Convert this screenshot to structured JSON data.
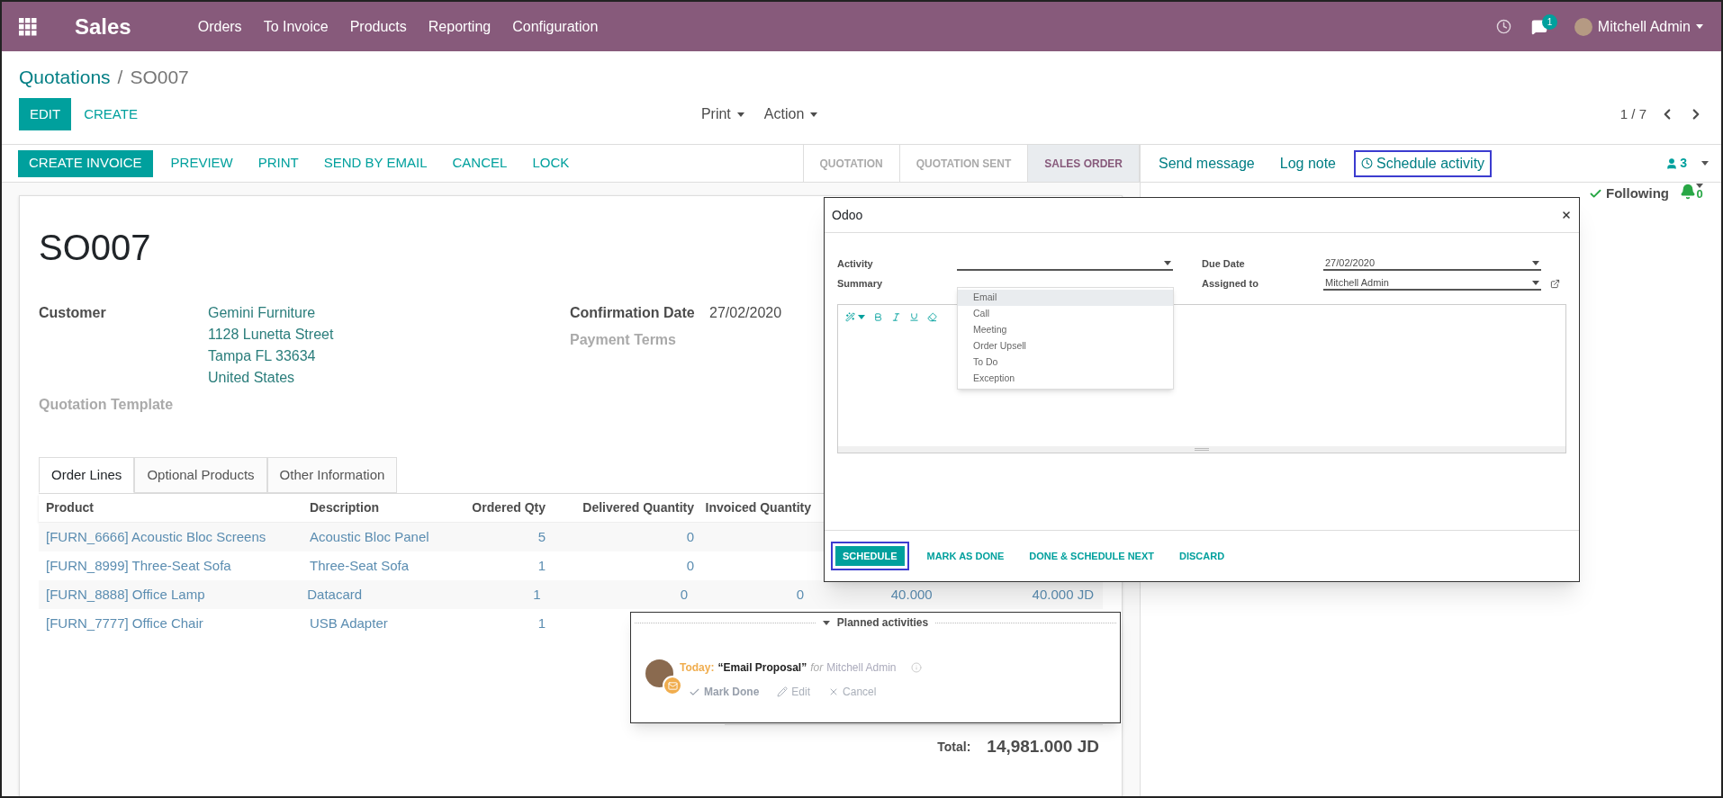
{
  "top_bar": {
    "app_name": "Sales",
    "menu": [
      "Orders",
      "To Invoice",
      "Products",
      "Reporting",
      "Configuration"
    ],
    "messages_badge": "1",
    "user_name": "Mitchell Admin"
  },
  "breadcrumb": {
    "parent": "Quotations",
    "separator": "/",
    "current": "SO007"
  },
  "control_panel": {
    "edit": "EDIT",
    "create": "CREATE",
    "dropdowns": [
      "Print",
      "Action"
    ],
    "pager": "1 / 7"
  },
  "status_bar": {
    "buttons": [
      {
        "label": "CREATE INVOICE",
        "kind": "primary"
      },
      {
        "label": "PREVIEW",
        "kind": "link"
      },
      {
        "label": "PRINT",
        "kind": "link"
      },
      {
        "label": "SEND BY EMAIL",
        "kind": "link"
      },
      {
        "label": "CANCEL",
        "kind": "link"
      },
      {
        "label": "LOCK",
        "kind": "link"
      }
    ],
    "stages": [
      {
        "label": "QUOTATION",
        "selected": false
      },
      {
        "label": "QUOTATION SENT",
        "selected": false
      },
      {
        "label": "SALES ORDER",
        "selected": true
      }
    ]
  },
  "chatter": {
    "buttons": [
      {
        "label": "Send message",
        "highlighted": false
      },
      {
        "label": "Log note",
        "highlighted": false
      },
      {
        "label": "Schedule activity",
        "highlighted": true
      }
    ],
    "followers_count": "3",
    "following": "Following",
    "notifications_count": "0"
  },
  "form": {
    "title": "SO007",
    "fields_left": [
      {
        "label": "Customer",
        "empty": false,
        "lines": [
          "Gemini Furniture",
          "1128 Lunetta Street",
          "Tampa FL 33634",
          "United States"
        ]
      },
      {
        "label": "Quotation Template",
        "empty": true
      }
    ],
    "fields_right": [
      {
        "label": "Confirmation Date",
        "empty": false,
        "value": "27/02/2020"
      },
      {
        "label": "Payment Terms",
        "empty": true
      }
    ],
    "tabs": [
      {
        "label": "Order Lines",
        "selected": true
      },
      {
        "label": "Optional Products",
        "selected": false
      },
      {
        "label": "Other Information",
        "selected": false
      }
    ],
    "table": {
      "columns": [
        "Product",
        "Description",
        "Ordered Qty",
        "Delivered Quantity",
        "Invoiced Quantity"
      ],
      "rows": [
        {
          "cells": [
            "[FURN_6666] Acoustic Bloc Screens",
            "Acoustic Bloc Panel",
            "5",
            "0"
          ]
        },
        {
          "cells": [
            "[FURN_8999] Three-Seat Sofa",
            "Three-Seat Sofa",
            "1",
            "0"
          ]
        },
        {
          "cells": [
            "[FURN_8888] Office Lamp",
            "Datacard",
            "1",
            "0",
            "0",
            "40.000",
            "40.000 JD"
          ]
        },
        {
          "cells": [
            "[FURN_7777] Office Chair",
            "USB Adapter",
            "1"
          ]
        }
      ]
    },
    "total": {
      "label": "Total:",
      "value": "14,981.000 JD"
    }
  },
  "dialog": {
    "title": "Odoo",
    "activity": {
      "label": "Activity"
    },
    "summary": {
      "label": "Summary"
    },
    "due_date": {
      "label": "Due Date",
      "value": "27/02/2020"
    },
    "assigned_to": {
      "label": "Assigned to",
      "value": "Mitchell Admin"
    },
    "activity_options": [
      {
        "label": "Email",
        "selected": true
      },
      {
        "label": "Call",
        "selected": false
      },
      {
        "label": "Meeting",
        "selected": false
      },
      {
        "label": "Order Upsell",
        "selected": false
      },
      {
        "label": "To Do",
        "selected": false
      },
      {
        "label": "Exception",
        "selected": false
      }
    ],
    "buttons": [
      {
        "label": "SCHEDULE",
        "kind": "primary",
        "highlighted": true
      },
      {
        "label": "MARK AS DONE",
        "kind": "link",
        "highlighted": false
      },
      {
        "label": "DONE & SCHEDULE NEXT",
        "kind": "link",
        "highlighted": false
      },
      {
        "label": "DISCARD",
        "kind": "link",
        "highlighted": false
      }
    ]
  },
  "planned_activities": {
    "title": "Planned activities",
    "due": "Today:",
    "activity": "“Email Proposal”",
    "for": "for",
    "assignee": "Mitchell Admin",
    "actions": [
      {
        "label": "Mark Done",
        "kind": "done"
      },
      {
        "label": "Edit",
        "kind": "edit"
      },
      {
        "label": "Cancel",
        "kind": "cancel"
      }
    ]
  }
}
